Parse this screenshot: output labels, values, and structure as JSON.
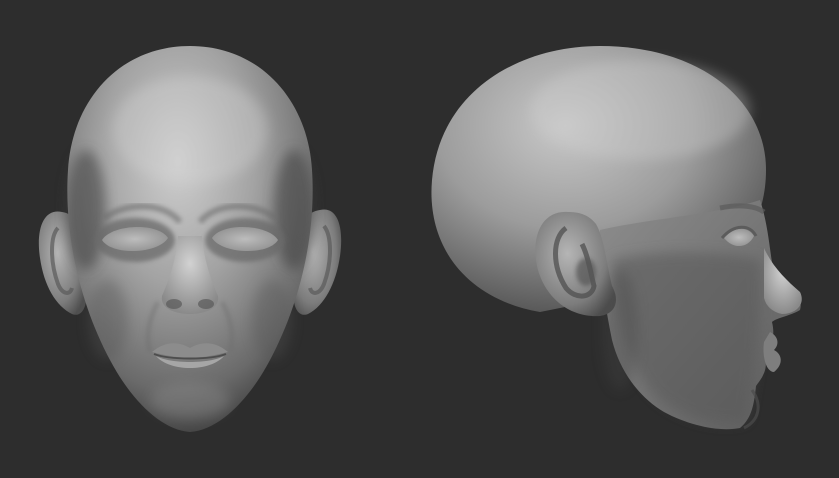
{
  "scene": {
    "background_color": "#2d2d2d",
    "clay_highlight": "#c9c9c9",
    "clay_mid": "#9a9a9a",
    "clay_shadow": "#4a4a4a",
    "views": [
      {
        "name": "front-view"
      },
      {
        "name": "side-view"
      }
    ]
  }
}
